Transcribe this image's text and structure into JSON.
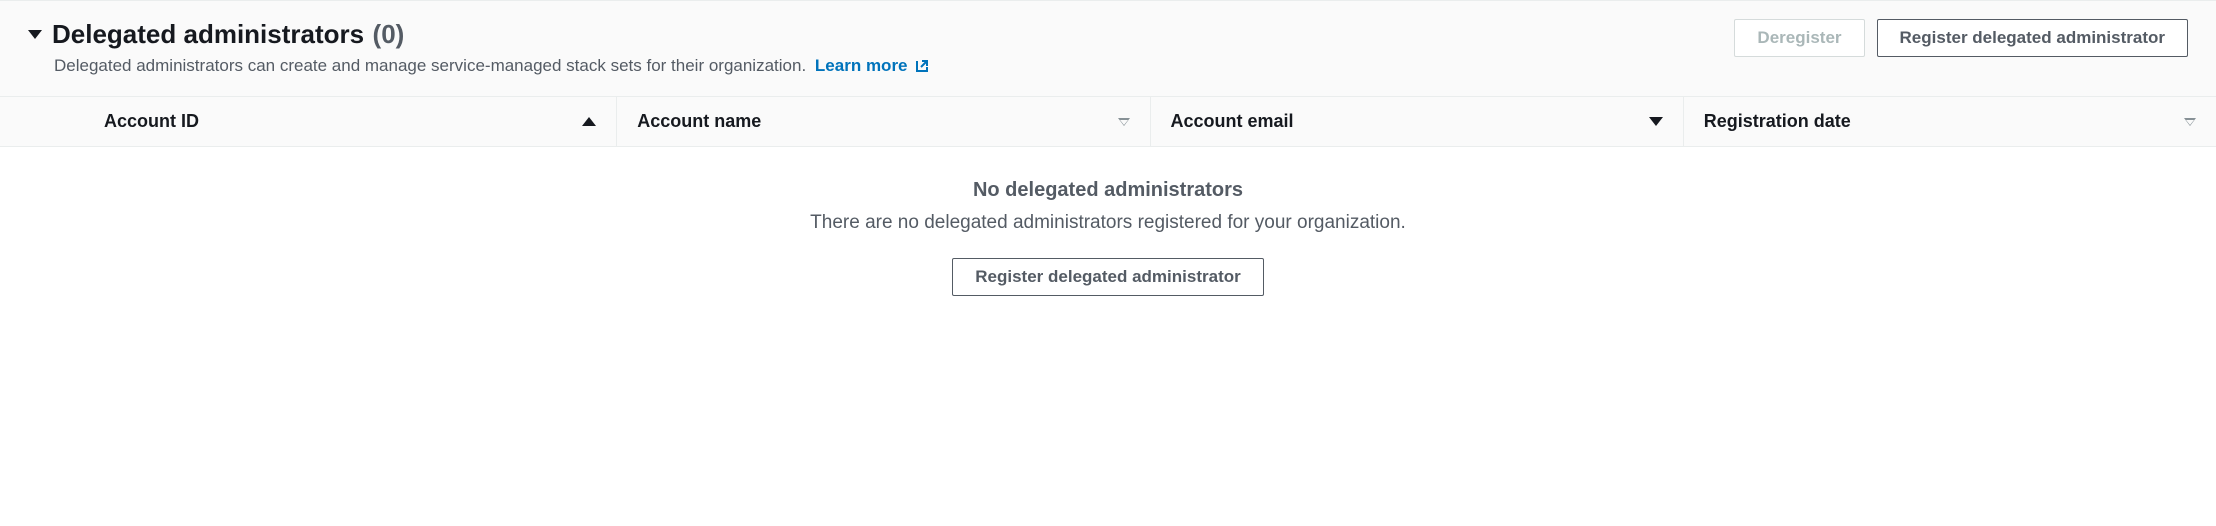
{
  "header": {
    "title": "Delegated administrators",
    "count": "(0)",
    "description": "Delegated administrators can create and manage service-managed stack sets for their organization.",
    "learn_more": "Learn more"
  },
  "actions": {
    "deregister": "Deregister",
    "register": "Register delegated administrator"
  },
  "table": {
    "columns": {
      "account_id": "Account ID",
      "account_name": "Account name",
      "account_email": "Account email",
      "registration_date": "Registration date"
    }
  },
  "empty": {
    "title": "No delegated administrators",
    "description": "There are no delegated administrators registered for your organization.",
    "button": "Register delegated administrator"
  }
}
